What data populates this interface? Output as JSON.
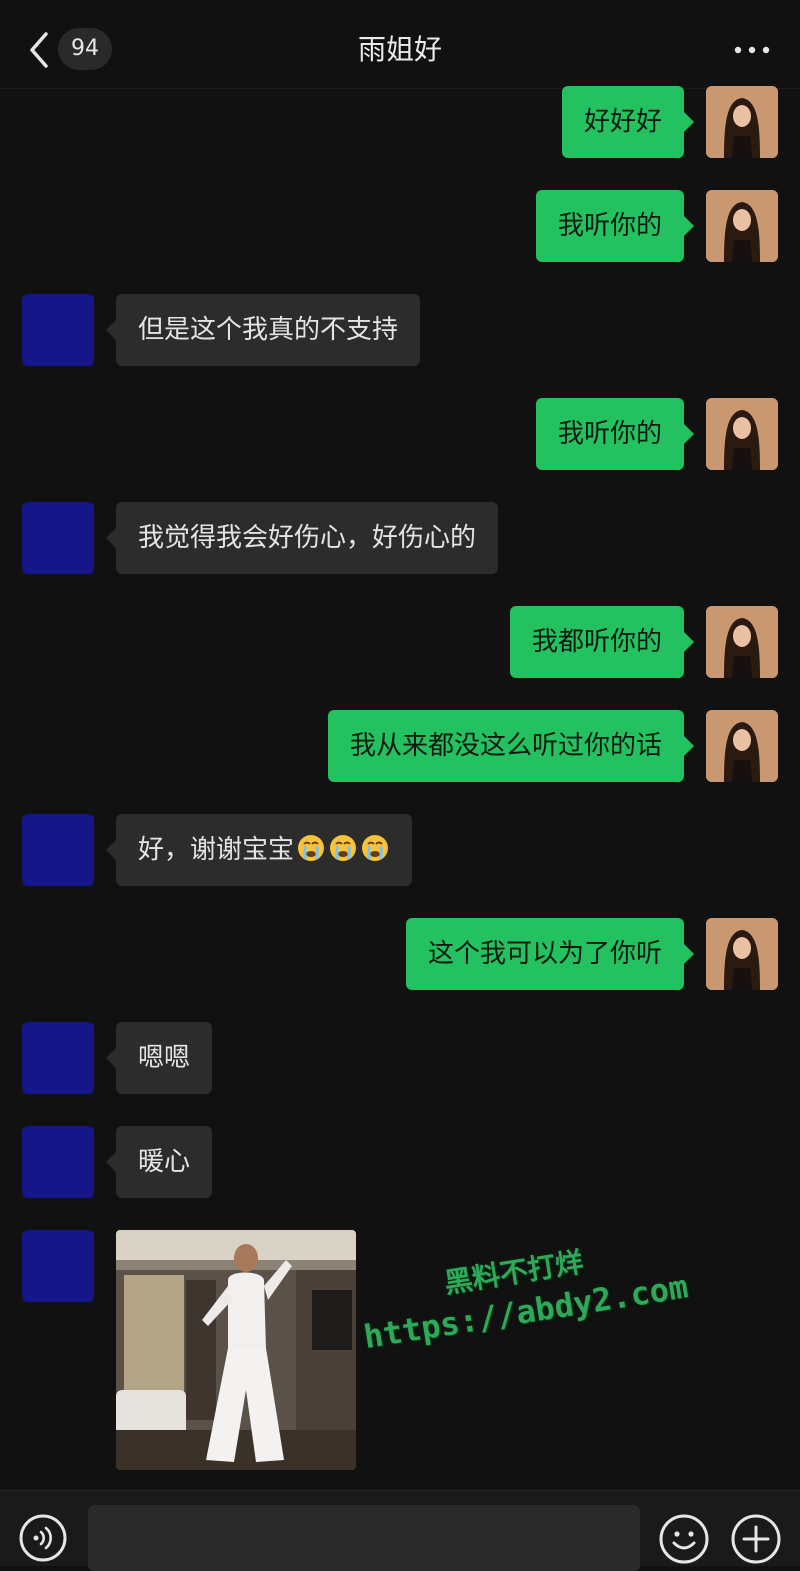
{
  "header": {
    "back_icon": "chevron-left-icon",
    "unread_count": "94",
    "title": "雨姐好",
    "more_icon": "ellipsis-icon"
  },
  "messages": [
    {
      "from": "me",
      "text": "好好好"
    },
    {
      "from": "me",
      "text": "我听你的"
    },
    {
      "from": "peer",
      "text": "但是这个我真的不支持"
    },
    {
      "from": "me",
      "text": "我听你的"
    },
    {
      "from": "peer",
      "text": "我觉得我会好伤心，好伤心的"
    },
    {
      "from": "me",
      "text": "我都听你的"
    },
    {
      "from": "me",
      "text": "我从来都没这么听过你的话"
    },
    {
      "from": "peer",
      "text": "好，谢谢宝宝",
      "emoji": "crying-face-icon",
      "emoji_count": 3
    },
    {
      "from": "me",
      "text": "这个我可以为了你听"
    },
    {
      "from": "peer",
      "text": "嗯嗯"
    },
    {
      "from": "peer",
      "text": "暖心"
    },
    {
      "from": "peer",
      "type": "image",
      "subject": "photo of a person dancing in a room"
    }
  ],
  "watermark": {
    "line1": "黑料不打烊",
    "line2": "https://abdy2.com"
  },
  "input_bar": {
    "voice_icon": "voice-icon",
    "emoji_icon": "smiley-icon",
    "plus_icon": "plus-icon"
  },
  "colors": {
    "background": "#111111",
    "outgoing_bubble": "#23c160",
    "incoming_bubble": "#2c2c2c",
    "peer_avatar": "#14168a",
    "watermark": "#2fa85a"
  }
}
